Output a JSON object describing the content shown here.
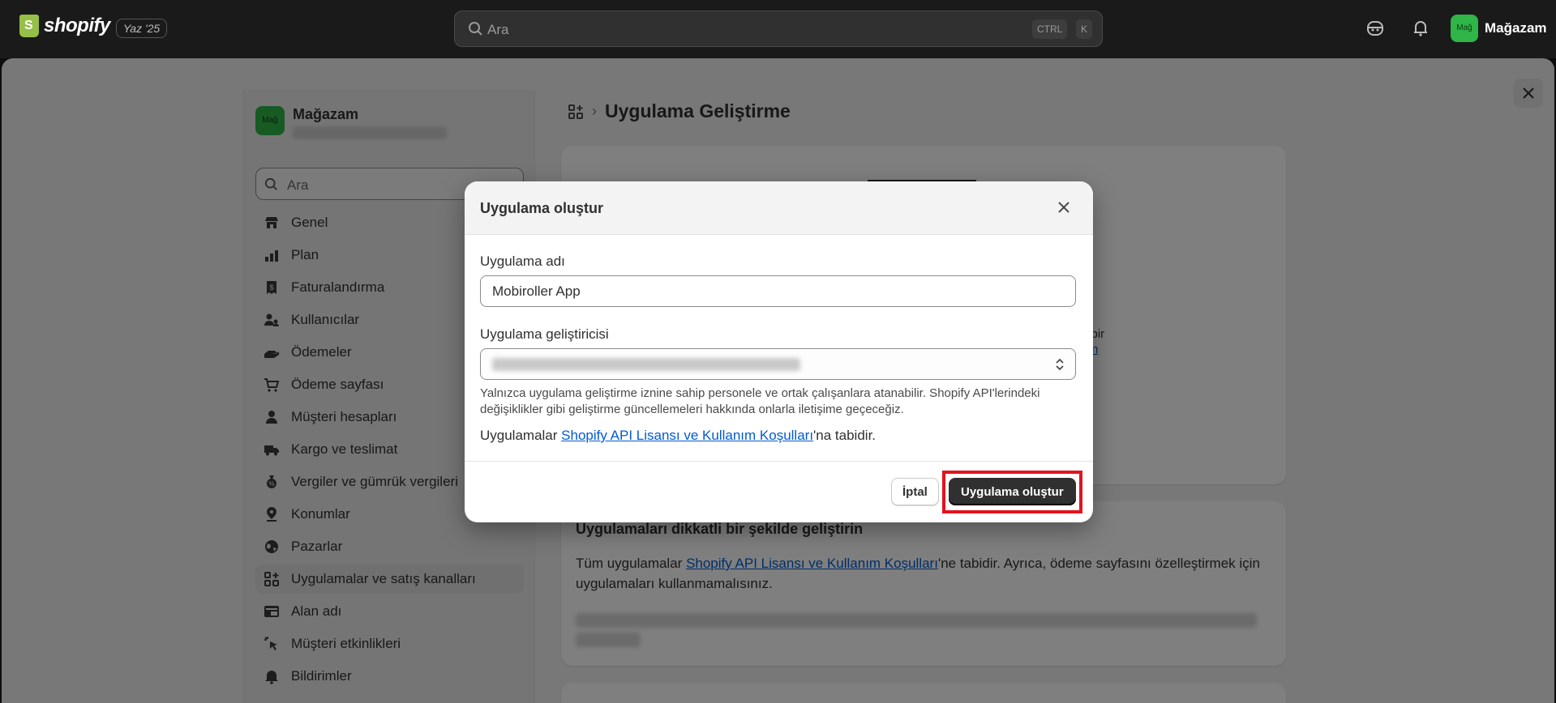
{
  "topbar": {
    "brand": "shopify",
    "edition_badge": "Yaz '25",
    "search_placeholder": "Ara",
    "shortcut_keys": [
      "CTRL",
      "K"
    ],
    "store_avatar": "Mağ",
    "store_name": "Mağazam"
  },
  "sidebar": {
    "store_avatar": "Mağ",
    "store_name": "Mağazam",
    "search_placeholder": "Ara",
    "items": [
      {
        "label": "Genel",
        "icon": "store-icon"
      },
      {
        "label": "Plan",
        "icon": "plan-icon"
      },
      {
        "label": "Faturalandırma",
        "icon": "receipt-icon"
      },
      {
        "label": "Kullanıcılar",
        "icon": "users-icon"
      },
      {
        "label": "Ödemeler",
        "icon": "payments-icon"
      },
      {
        "label": "Ödeme sayfası",
        "icon": "cart-icon"
      },
      {
        "label": "Müşteri hesapları",
        "icon": "person-icon"
      },
      {
        "label": "Kargo ve teslimat",
        "icon": "truck-icon"
      },
      {
        "label": "Vergiler ve gümrük vergileri",
        "icon": "tax-icon"
      },
      {
        "label": "Konumlar",
        "icon": "location-icon"
      },
      {
        "label": "Pazarlar",
        "icon": "globe-icon"
      },
      {
        "label": "Uygulamalar ve satış kanalları",
        "icon": "apps-icon",
        "active": true
      },
      {
        "label": "Alan adı",
        "icon": "domain-icon"
      },
      {
        "label": "Müşteri etkinlikleri",
        "icon": "cursor-icon"
      },
      {
        "label": "Bildirimler",
        "icon": "bell-icon"
      }
    ]
  },
  "main": {
    "page_title": "Uygulama Geliştirme",
    "card1_fragments": [
      "l bir",
      "n"
    ],
    "card2": {
      "title": "Uygulamaları dikkatli bir şekilde geliştirin",
      "text_before_link": "Tüm uygulamalar ",
      "link": "Shopify API Lisansı ve Kullanım Koşulları",
      "text_after_link": "'ne tabidir. Ayrıca, ödeme sayfasını özelleştirmek için uygulamaları kullanmamalısınız."
    }
  },
  "modal": {
    "title": "Uygulama oluştur",
    "app_name_label": "Uygulama adı",
    "app_name_value": "Mobiroller App",
    "developer_label": "Uygulama geliştiricisi",
    "help_text": "Yalnızca uygulama geliştirme iznine sahip personele ve ortak çalışanlara atanabilir. Shopify API'lerindeki değişiklikler gibi geliştirme güncellemeleri hakkında onlarla iletişime geçeceğiz.",
    "terms_prefix": "Uygulamalar ",
    "terms_link": "Shopify API Lisansı ve Kullanım Koşulları",
    "terms_suffix": "'na tabidir.",
    "cancel_label": "İptal",
    "create_label": "Uygulama oluştur"
  },
  "colors": {
    "accent_highlight": "#e0141e",
    "primary_button": "#303030",
    "link": "#005bd3",
    "avatar": "#2fb548"
  }
}
